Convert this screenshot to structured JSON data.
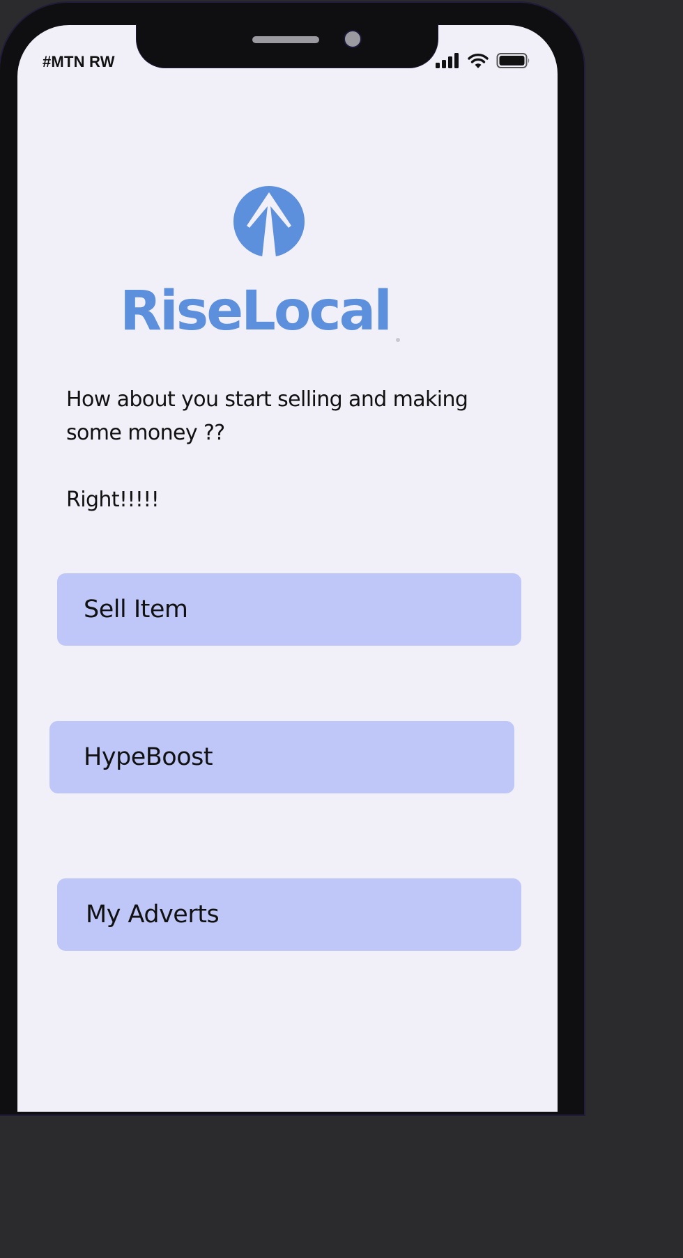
{
  "status_bar": {
    "carrier": "#MTN RW",
    "icons": [
      "cellular-signal-icon",
      "wifi-icon",
      "battery-icon"
    ]
  },
  "logo": {
    "icon": "up-arrow-icon",
    "brand_name": "RiseLocal"
  },
  "message": {
    "prompt": "How about you start selling and making some money ??",
    "exclamation": "Right!!!!!"
  },
  "actions": {
    "sell_label": "Sell Item",
    "hype_label": "HypeBoost",
    "adverts_label": "My Adverts"
  },
  "colors": {
    "brand": "#5c8fdc",
    "button_bg": "#bec7f8",
    "screen_bg": "#f1f0f9",
    "frame": "#0f0f11"
  }
}
